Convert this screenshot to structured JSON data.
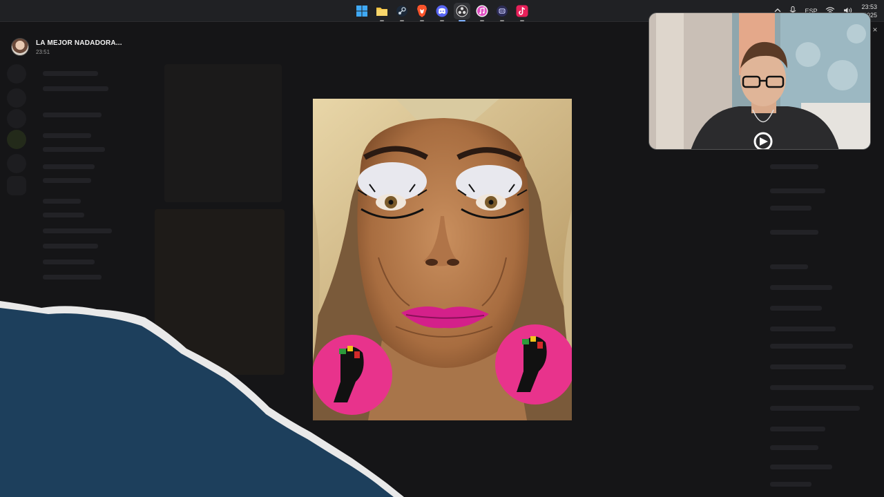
{
  "taskbar": {
    "apps": [
      {
        "name": "windows-start-icon"
      },
      {
        "name": "file-explorer-icon"
      },
      {
        "name": "steam-icon"
      },
      {
        "name": "brave-browser-icon"
      },
      {
        "name": "discord-icon"
      },
      {
        "name": "obs-icon"
      },
      {
        "name": "itunes-icon"
      },
      {
        "name": "media-icon"
      },
      {
        "name": "tiktok-icon"
      }
    ],
    "tray": {
      "language": "ESP",
      "time": "23:53",
      "date": "2025"
    }
  },
  "viewer": {
    "title": "LA MEJOR NADADORA...",
    "time": "23:51",
    "close_label": "×"
  },
  "colors": {
    "torn_blue": "#1d3f5c",
    "torn_edge": "#e9e9e9",
    "lips": "#d4208a",
    "earring": "#e8338c"
  }
}
